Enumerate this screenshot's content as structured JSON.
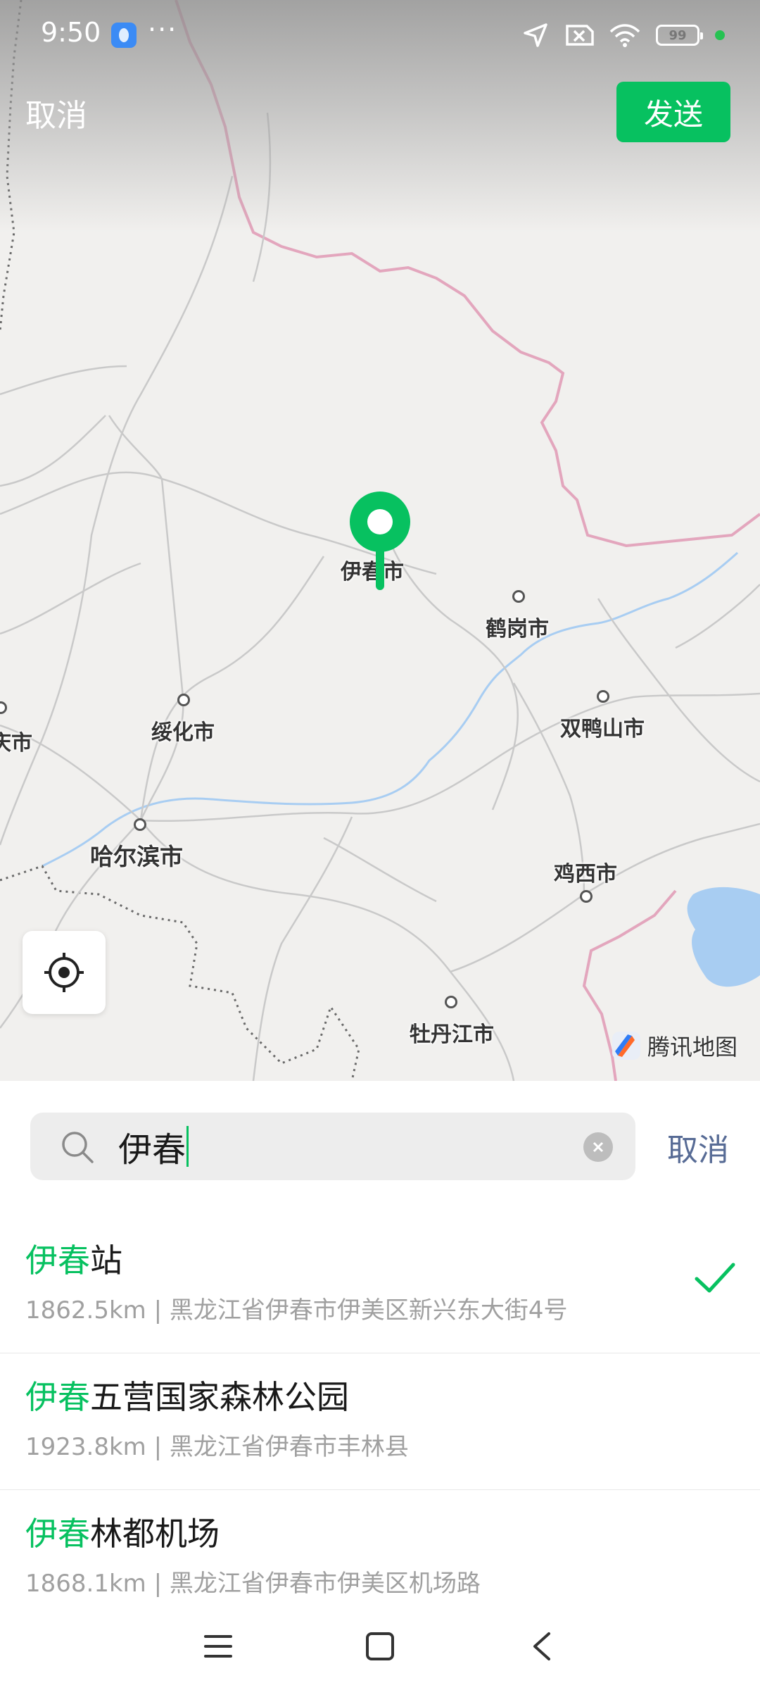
{
  "status_bar": {
    "time": "9:50",
    "dots": "···",
    "battery_level": "99",
    "icons": [
      "app-notification-icon",
      "location-arrow-icon",
      "sim-off-icon",
      "wifi-icon",
      "battery-icon",
      "status-green-dot"
    ]
  },
  "header": {
    "cancel_label": "取消",
    "send_label": "发送"
  },
  "map": {
    "cities": [
      "伊春市",
      "鹤岗市",
      "绥化市",
      "双鸭山市",
      "哈尔滨市",
      "鸡西市",
      "牡丹江市",
      "庆市"
    ],
    "provider_logo": "腾讯地图",
    "pin_color": "#07c160"
  },
  "search": {
    "query": "伊春",
    "cancel_label": "取消"
  },
  "results": [
    {
      "highlight": "伊春",
      "rest": "站",
      "distance": "1862.5km",
      "separator": "|",
      "address": "黑龙江省伊春市伊美区新兴东大街4号",
      "selected": true
    },
    {
      "highlight": "伊春",
      "rest": "五营国家森林公园",
      "distance": "1923.8km",
      "separator": "|",
      "address": "黑龙江省伊春市丰林县",
      "selected": false
    },
    {
      "highlight": "伊春",
      "rest": "林都机场",
      "distance": "1868.1km",
      "separator": "|",
      "address": "黑龙江省伊春市伊美区机场路",
      "selected": false
    }
  ],
  "colors": {
    "accent_green": "#07c160",
    "link_blue": "#576b95",
    "border_pink": "#e8a0b8"
  }
}
